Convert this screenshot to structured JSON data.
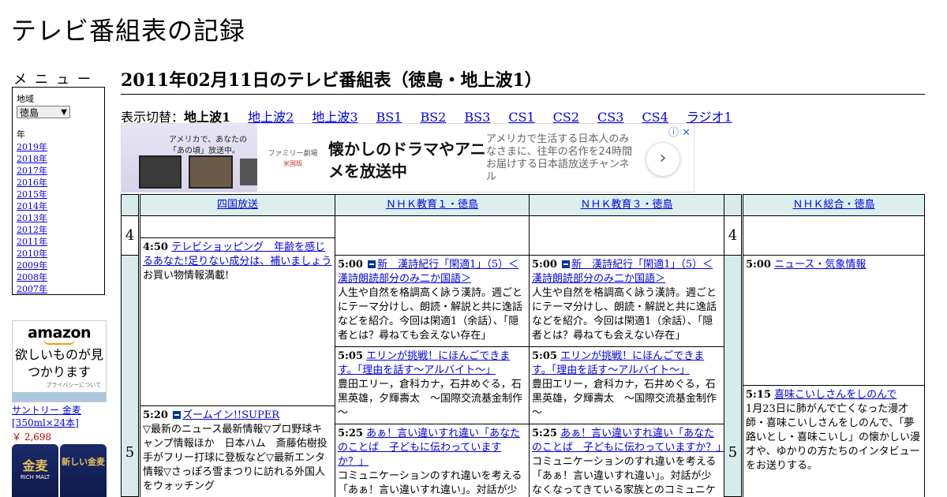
{
  "site": {
    "title": "テレビ番組表の記録"
  },
  "sidebar": {
    "menu_label": "メニュー",
    "region_label": "地域",
    "region_value": "徳島",
    "year_label": "年",
    "years": [
      "2019年",
      "2018年",
      "2017年",
      "2016年",
      "2015年",
      "2014年",
      "2013年",
      "2012年",
      "2011年",
      "2010年",
      "2009年",
      "2008年",
      "2007年"
    ]
  },
  "sidebar_ad": {
    "brand": "amazon",
    "message": "欲しいものが見つかります",
    "privacy": "プライバシーについて",
    "product_name": "サントリー 金麦[350ml×24本]",
    "product_price": "￥ 2,698",
    "can1": "金麦",
    "can1_sub": "RICH MALT",
    "can2": "新しい金麦"
  },
  "main": {
    "title": "2011年02月11日のテレビ番組表（徳島・地上波1）",
    "switch_label": "表示切替：",
    "current": "地上波1",
    "links": [
      "地上波2",
      "地上波3",
      "BS1",
      "BS2",
      "BS3",
      "CS1",
      "CS2",
      "CS3",
      "CS4",
      "ラジオ1"
    ]
  },
  "ad": {
    "img_caption": "アメリカで、あなたの「あの頃」放送中。",
    "logo": "ファミリー劇場",
    "logo_sub": "米国版",
    "headline": "懐かしのドラマやアニメを放送中",
    "desc": "アメリカで生活する日本人のみなさまに、往年の名作を24時間お届けする日本語放送チャンネル",
    "next": "›",
    "close": "ⓘ ✕"
  },
  "schedule": {
    "channels": [
      "四国放送",
      "ＮＨＫ教育１・徳島",
      "ＮＨＫ教育３・徳島",
      "ＮＨＫ総合・徳島"
    ],
    "hours": [
      "4",
      "5",
      "4",
      "5"
    ],
    "programs": {
      "p1": {
        "time": "4:50",
        "title": "テレビショッピング　年齢を感じるあなた!足りない成分は、補いましょう",
        "desc": "お買い物情報満載!"
      },
      "p2": {
        "time": "5:20",
        "title": "ズームイン!!SUPER",
        "desc": "▽最新のニュース最新情報▽プロ野球キャンプ情報ほか　日本ハム　斎藤佑樹投手がフリー打球に登板など▽最新エンタ情報▽さっぽろ雪まつりに訪れる外国人をウォッチング"
      },
      "p3": {
        "time": "5:00",
        "title": "新　漢詩紀行「閑適1」（5）＜漢詩朗読部分のみ二か国語＞",
        "desc": "人生や自然を格調高く詠う漢詩。週ごとにテーマ分けし、朗読・解説と共に逸話などを紹介。今回は閑適1（余話）、「隠者とは？尋ねても会えない存在」"
      },
      "p4": {
        "time": "5:05",
        "title": "エリンが挑戦！にほんごできます。「理由を話す～アルバイト～」",
        "desc": "豊田エリー，倉科カナ，石井めぐる，石黒英雄，夕輝壽太　～国際交流基金制作～"
      },
      "p5": {
        "time": "5:25",
        "title": "あぁ！言い違いすれ違い「あなたのことば　子どもに伝わっていますか？」",
        "desc": "コミュニケーションのすれ違いを考える「あぁ！言い違いすれ違い」。対話が少なくなってきている家族とのコミュニケ"
      },
      "p6": {
        "time": "5:00",
        "title": "新　漢詩紀行「閑適1」（5）＜漢詩朗読部分のみ二か国語＞",
        "desc": "人生や自然を格調高く詠う漢詩。週ごとにテーマ分けし、朗読・解説と共に逸話などを紹介。今回は閑適1（余話）、「隠者とは？尋ねても会えない存在」"
      },
      "p7": {
        "time": "5:05",
        "title": "エリンが挑戦！にほんごできます。「理由を話す～アルバイト～」",
        "desc": "豊田エリー，倉科カナ，石井めぐる，石黒英雄，夕輝壽太　～国際交流基金制作～"
      },
      "p8": {
        "time": "5:25",
        "title": "あぁ！言い違いすれ違い「あなたのことば　子どもに伝わっていますか？」",
        "desc": "コミュニケーションのすれ違いを考える「あぁ！言い違いすれ違い」。対話が少なくなってきている家族とのコミュニケ"
      },
      "p9": {
        "time": "5:00",
        "title": "ニュース・気象情報",
        "desc": ""
      },
      "p10": {
        "time": "5:15",
        "title": "喜味こいしさんをしのんで",
        "desc": "1月23日に肺がんで亡くなった漫才師・喜味こいしさんをしのんで、「夢路いとし・喜味こいし」の懐かしい漫才や、ゆかりの方たちのインタビューをお送りする。"
      }
    }
  }
}
